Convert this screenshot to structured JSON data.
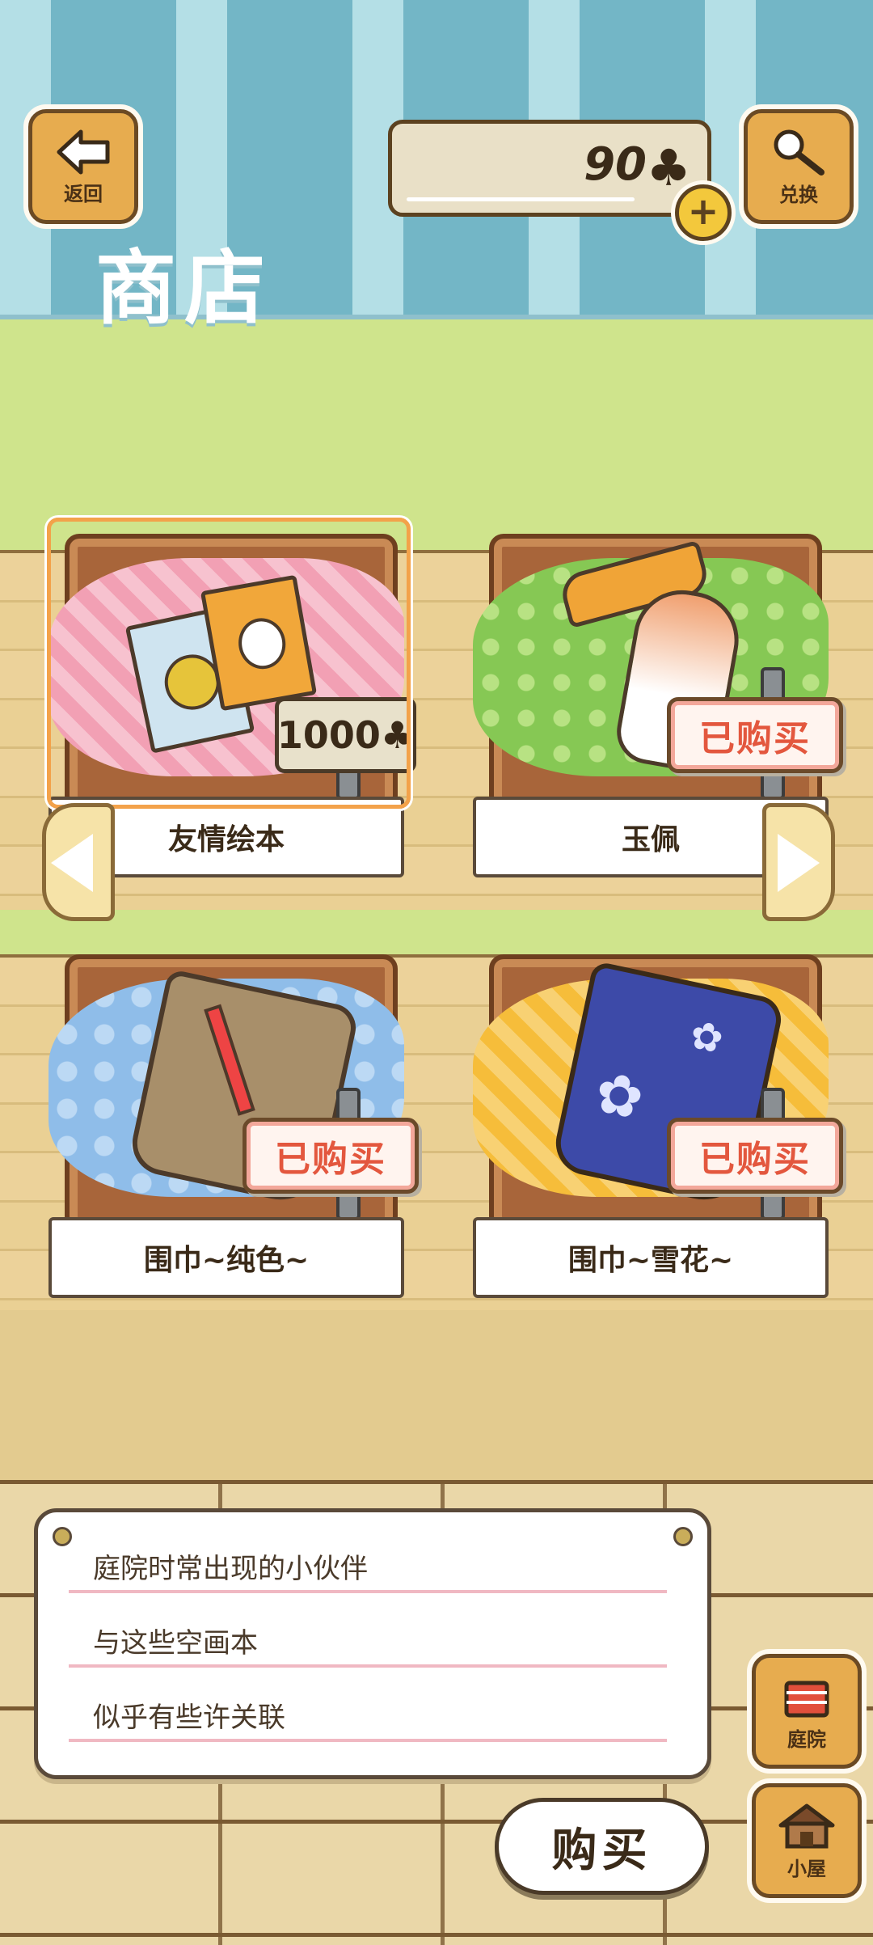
{
  "top_bar": {
    "back_label": "返回",
    "clover_count": "90",
    "clover_symbol": "♣",
    "exchange_label": "兑换",
    "plus_symbol": "+",
    "shop_title": "商店"
  },
  "items": [
    {
      "name": "友情绘本",
      "price": "1000♣",
      "status": "",
      "cloth": "pink"
    },
    {
      "name": "玉佩",
      "price": "",
      "status": "已购买",
      "cloth": "green"
    },
    {
      "name": "围巾~纯色~",
      "price": "",
      "status": "已购买",
      "cloth": "blue"
    },
    {
      "name": "围巾~雪花~",
      "price": "",
      "status": "已购买",
      "cloth": "yellow"
    }
  ],
  "description": {
    "lines": [
      "庭院时常出现的小伙伴",
      "与这些空画本",
      "似乎有些许关联"
    ]
  },
  "buy_label": "购买",
  "nav": {
    "yard_label": "庭院",
    "house_label": "小屋"
  },
  "icons": [
    "back-arrow-icon",
    "magnifier-icon",
    "clover-icon",
    "plus-icon",
    "prev-arrow-icon",
    "next-arrow-icon",
    "yard-icon",
    "house-icon"
  ],
  "colors": {
    "accent": "#e7ac4f",
    "bought": "#e3573e",
    "selection": "#f3a24a"
  }
}
